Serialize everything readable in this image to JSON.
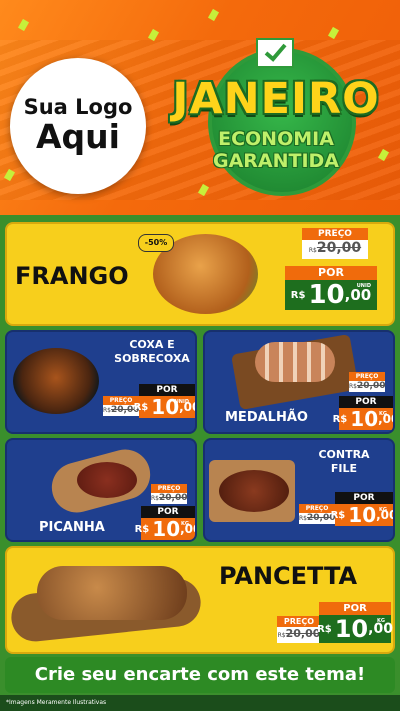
{
  "header": {
    "logo_line1": "Sua Logo",
    "logo_line2": "Aqui",
    "title": "JANEIRO",
    "subtitle_line1": "ECONOMIA",
    "subtitle_line2": "GARANTIDA"
  },
  "products": {
    "frango": {
      "name": "FRANGO",
      "discount": "-50%",
      "price_label": "PREÇO",
      "old_currency": "R$",
      "old_price": "20,00",
      "por_label": "POR",
      "currency": "R$",
      "price_int": "10",
      "price_dec": ",00",
      "unit": "UNID"
    },
    "coxa": {
      "name_line1": "COXA E",
      "name_line2": "SOBRECOXA",
      "price_label": "PREÇO",
      "old_currency": "R$",
      "old_price": "20,00",
      "por_label": "POR",
      "currency": "R$",
      "price_int": "10",
      "price_dec": ",00",
      "unit": "UNID"
    },
    "medalhao": {
      "name": "MEDALHÃO",
      "price_label": "PREÇO",
      "old_currency": "R$",
      "old_price": "20,00",
      "por_label": "POR",
      "currency": "R$",
      "price_int": "10",
      "price_dec": ",00",
      "unit": "KG"
    },
    "picanha": {
      "name": "PICANHA",
      "price_label": "PREÇO",
      "old_currency": "R$",
      "old_price": "20,00",
      "por_label": "POR",
      "currency": "R$",
      "price_int": "10",
      "price_dec": ",00",
      "unit": "KG"
    },
    "contrafile": {
      "name_line1": "CONTRA",
      "name_line2": "FILE",
      "price_label": "PREÇO",
      "old_currency": "R$",
      "old_price": "20,00",
      "por_label": "POR",
      "currency": "R$",
      "price_int": "10",
      "price_dec": ",00",
      "unit": "KG"
    },
    "pancetta": {
      "name": "PANCETTA",
      "price_label": "PREÇO",
      "old_currency": "R$",
      "old_price": "20,00",
      "por_label": "POR",
      "currency": "R$",
      "price_int": "10",
      "price_dec": ",00",
      "unit": "KG"
    }
  },
  "cta": "Crie seu encarte com este tema!",
  "footnote": "*Imagens Meramente Ilustrativas",
  "colors": {
    "orange": "#f06b0c",
    "yellow": "#f7cf1c",
    "blue": "#1f3f8e",
    "green": "#2d8a24"
  }
}
